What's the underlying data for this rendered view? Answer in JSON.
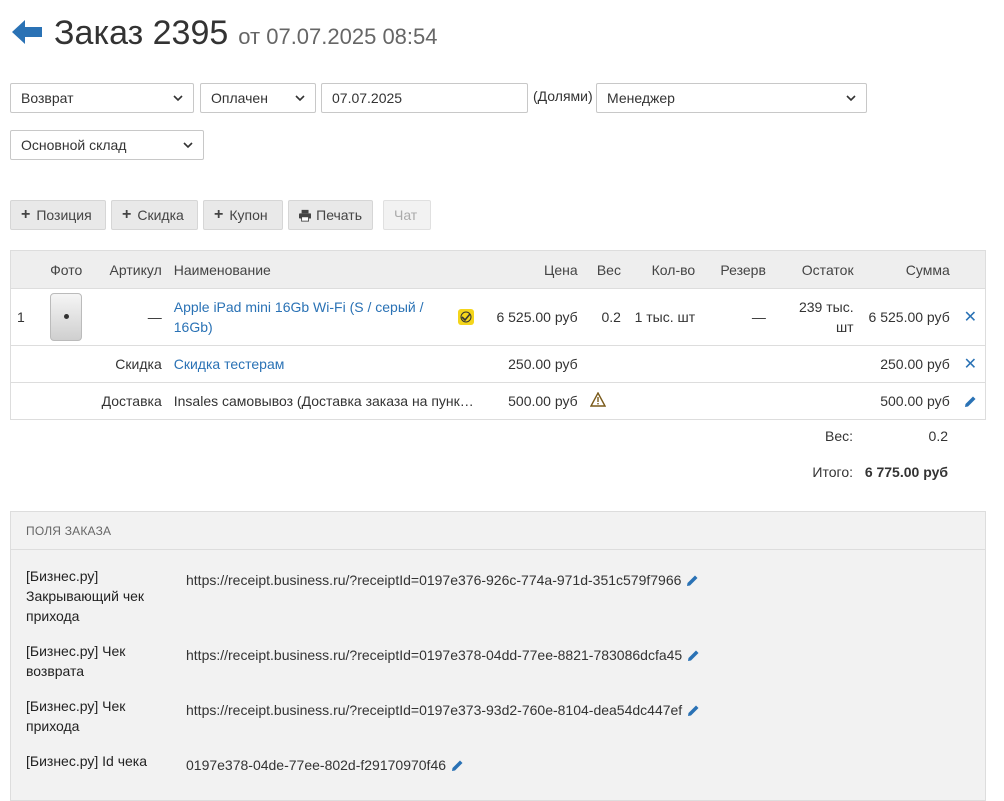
{
  "header": {
    "title": "Заказ 2395",
    "date_prefix": "от 07.07.2025 08:54"
  },
  "filters": {
    "status": "Возврат",
    "payment": "Оплачен",
    "date": "07.07.2025",
    "payment_method": "(Долями)",
    "manager": "Менеджер",
    "warehouse": "Основной склад"
  },
  "toolbar": {
    "add_position": "Позиция",
    "add_discount": "Скидка",
    "add_coupon": "Купон",
    "print": "Печать",
    "chat": "Чат"
  },
  "table": {
    "headers": {
      "photo": "Фото",
      "sku": "Артикул",
      "name": "Наименование",
      "price": "Цена",
      "weight": "Вес",
      "qty": "Кол-во",
      "reserve": "Резерв",
      "stock": "Остаток",
      "sum": "Сумма"
    },
    "item": {
      "index": "1",
      "sku": "—",
      "name": "Apple iPad mini 16Gb Wi-Fi (S / серый / 16Gb)",
      "price": "6 525.00 руб",
      "weight": "0.2",
      "qty": "1 тыс. шт",
      "reserve": "—",
      "stock": "239 тыс. шт",
      "sum": "6 525.00 руб"
    },
    "discount": {
      "label": "Скидка",
      "name": "Скидка тестерам",
      "price": "250.00 руб",
      "sum": "250.00 руб"
    },
    "delivery": {
      "label": "Доставка",
      "name": "Insales самовывоз (Доставка заказа на пунк…",
      "price": "500.00 руб",
      "sum": "500.00 руб"
    }
  },
  "totals": {
    "weight_label": "Вес:",
    "weight_value": "0.2",
    "total_label": "Итого:",
    "total_value": "6 775.00 руб"
  },
  "order_fields": {
    "title": "ПОЛЯ ЗАКАЗА",
    "fields": [
      {
        "label": "[Бизнес.ру] Закрывающий чек прихода",
        "value": "https://receipt.business.ru/?receiptId=0197e376-926c-774a-971d-351c579f7966"
      },
      {
        "label": "[Бизнес.ру] Чек возврата",
        "value": "https://receipt.business.ru/?receiptId=0197e378-04dd-77ee-8821-783086dcfa45"
      },
      {
        "label": "[Бизнес.ру] Чек прихода",
        "value": "https://receipt.business.ru/?receiptId=0197e373-93d2-760e-8104-dea54dc447ef"
      },
      {
        "label": "[Бизнес.ру] Id чека",
        "value": "0197e378-04de-77ee-802d-f29170970f46"
      }
    ]
  },
  "colors": {
    "accent": "#2a72b5",
    "badge": "#f4d51b",
    "warning": "#7a5a1a"
  },
  "icons": [
    "arrow-left-icon",
    "chevron-down-icon",
    "plus-icon",
    "printer-icon",
    "sync-badge-icon",
    "close-icon",
    "warning-icon",
    "pencil-icon"
  ]
}
